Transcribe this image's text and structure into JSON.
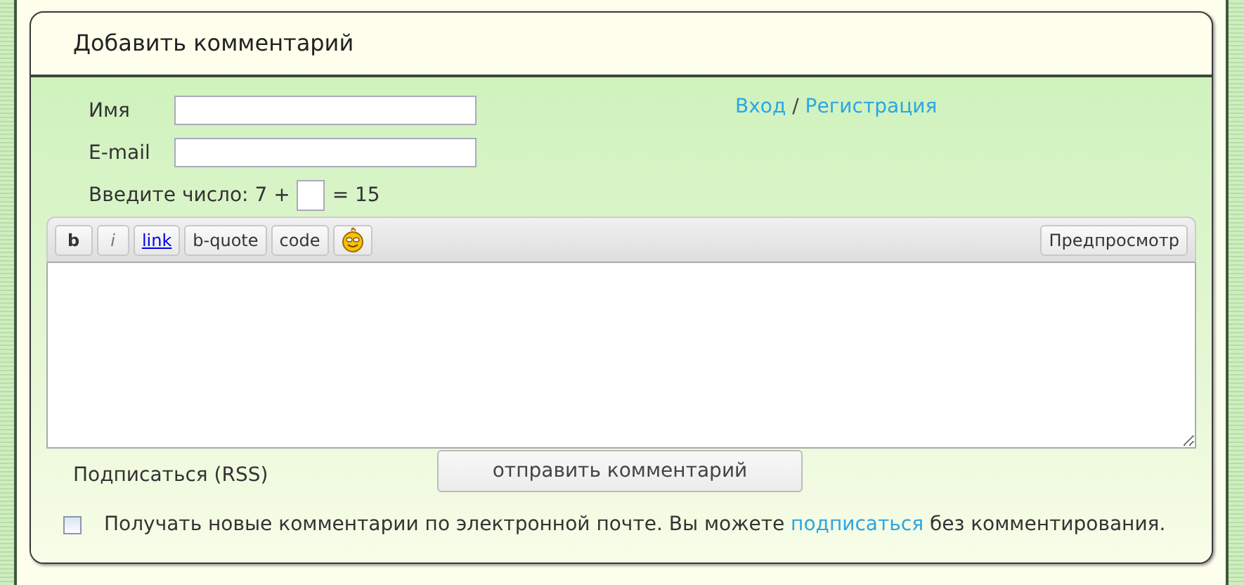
{
  "panel": {
    "title": "Добавить комментарий"
  },
  "form": {
    "fields": [
      {
        "label": "Имя",
        "kind": "text"
      },
      {
        "label": "E-mail",
        "kind": "text"
      }
    ],
    "auth_links": [
      {
        "label": "Вход"
      },
      {
        "label": "Регистрация"
      }
    ],
    "auth_separator": "/",
    "captcha": {
      "prefix": "Введите число: 7 +",
      "suffix": "= 15"
    }
  },
  "toolbar": {
    "buttons": [
      {
        "kind": "bold",
        "label": "b"
      },
      {
        "kind": "italic",
        "label": "i"
      },
      {
        "kind": "link",
        "label": "link"
      },
      {
        "kind": "plain",
        "label": "b-quote"
      },
      {
        "kind": "plain",
        "label": "code"
      },
      {
        "kind": "smiley"
      }
    ],
    "preview": "Предпросмотр"
  },
  "rss_link": "Подписаться (RSS)",
  "submit": "отправить комментарий",
  "subscribe": {
    "checked": false,
    "text_before": "Получать новые комментарии по электронной почте. Вы можете",
    "link": "подписаться",
    "text_after": "без комментирования."
  }
}
